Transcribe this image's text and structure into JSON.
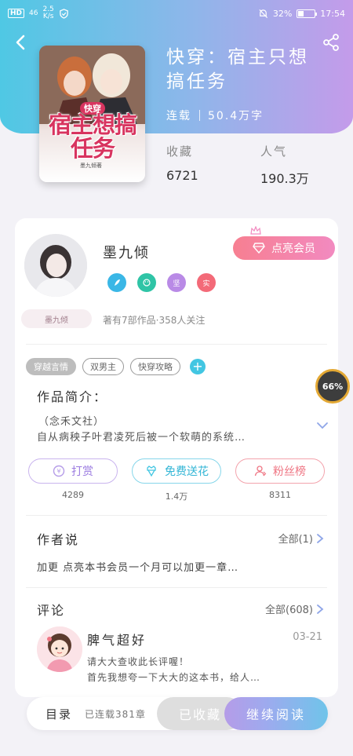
{
  "status_bar": {
    "hd": "HD",
    "signal": "46",
    "net_speed_value": "2.5",
    "net_speed_unit": "K/s",
    "battery": "32%",
    "battery_level": 0.32,
    "time": "17:54"
  },
  "book": {
    "title_line1": "快穿：宿主只想",
    "title_line2": "搞任务",
    "status": "连载",
    "word_count": "50.4万字",
    "collections_label": "收藏",
    "collections_value": "6721",
    "popularity_label": "人气",
    "popularity_value": "190.3万",
    "cover_series": "快穿",
    "cover_title": "宿主想搞任务",
    "cover_author": "墨九倾著"
  },
  "author": {
    "name": "墨九倾",
    "vip_button": "点亮会员",
    "badges": [
      "",
      "",
      "坚",
      "实"
    ],
    "name_plate": "墨九倾",
    "stats": "著有7部作品·358人关注"
  },
  "tags": [
    "穿越言情",
    "双男主",
    "快穿攻略"
  ],
  "intro": {
    "heading": "作品简介：",
    "line1": "（念禾文社）",
    "line2": "自从病秧子叶君凌死后被一个软萌的系统…"
  },
  "actions": [
    {
      "label": "打赏",
      "count": "4289"
    },
    {
      "label": "免费送花",
      "count": "1.4万"
    },
    {
      "label": "粉丝榜",
      "count": "8311"
    }
  ],
  "author_notes": {
    "heading": "作者说",
    "more": "全部(1)",
    "text": "加更 点亮本书会员一个月可以加更一章…"
  },
  "comments": {
    "heading": "评论",
    "more": "全部(608)",
    "items": [
      {
        "user": "脾气超好",
        "date": "03-21",
        "line1": "请大大查收此长评喔！",
        "line2": "首先我想夸一下大大的这本书，给人…"
      }
    ]
  },
  "bottom_bar": {
    "toc": "目录",
    "toc_status": "已连载381章",
    "collect": "已收藏",
    "read": "继续阅读"
  },
  "reading_progress": "66%",
  "colors": {
    "accent_blue": "#42c6e2",
    "accent_pink": "#f77f91",
    "accent_purple": "#b59ce8"
  }
}
